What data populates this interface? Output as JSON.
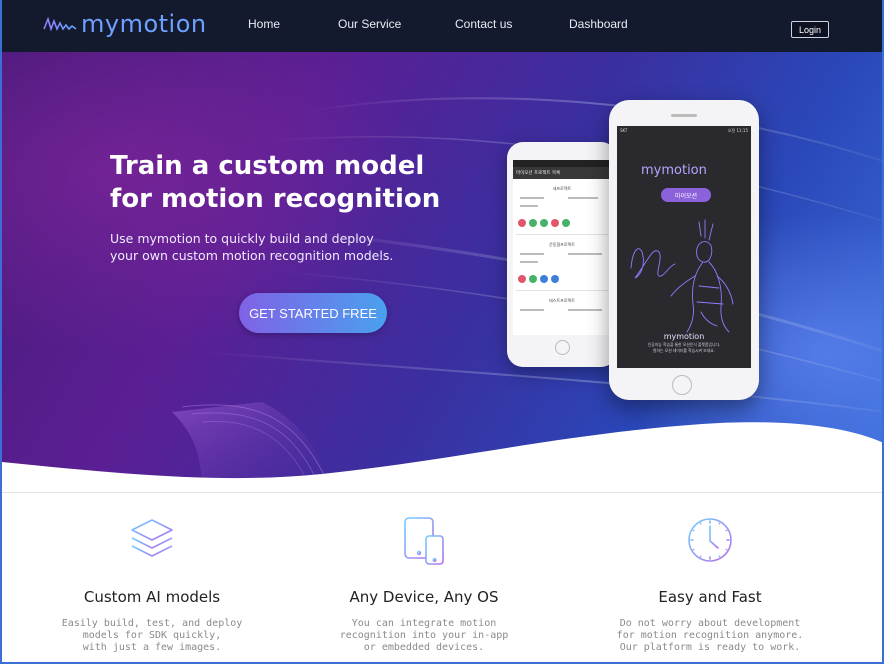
{
  "brand": {
    "name": "mymotion",
    "logo_color": "#6ea0ff"
  },
  "nav": {
    "items": [
      {
        "label": "Home"
      },
      {
        "label": "Our Service"
      },
      {
        "label": "Contact us"
      },
      {
        "label": "Dashboard"
      }
    ],
    "login_label": "Login"
  },
  "hero": {
    "title_line1": "Train a custom model",
    "title_line2": "for motion recognition",
    "subtitle_line1": "Use mymotion to quickly build and deploy",
    "subtitle_line2": "your own custom motion recognition models.",
    "cta_label": "GET STARTED FREE"
  },
  "phone_back": {
    "header": "마이모션 프로젝트 목록",
    "cards": [
      {
        "title": "새프로젝트"
      },
      {
        "title": "운동협프로젝트"
      },
      {
        "title": "테스트프로젝트"
      }
    ]
  },
  "phone_front": {
    "status_left": "SKT",
    "status_right": "오전 11:15",
    "app_logo": "mymotion",
    "button_label": "마이모션",
    "footer_brand": "mymotion",
    "footer_line1": "인공지능 학습을 통한 모션인식 플랫폼입니다.",
    "footer_line2": "원하는 모션 데이터를 학습시켜 보세요."
  },
  "features": [
    {
      "icon": "layers-icon",
      "title": "Custom AI models",
      "desc_line1": "Easily build, test, and deploy",
      "desc_line2": "models for SDK quickly,",
      "desc_line3": "with just a few images."
    },
    {
      "icon": "devices-icon",
      "title": "Any Device, Any OS",
      "desc_line1": "You can integrate motion",
      "desc_line2": "recognition into your in-app",
      "desc_line3": "or embedded devices."
    },
    {
      "icon": "clock-icon",
      "title": "Easy and Fast",
      "desc_line1": "Do not worry about development",
      "desc_line2": "for motion recognition anymore.",
      "desc_line3": "Our platform is ready to work."
    }
  ],
  "colors": {
    "nav_bg": "#141a2e",
    "hero_purple": "#5a1f94",
    "hero_blue": "#3c6fdb",
    "cta_start": "#8062e6",
    "cta_end": "#4aa0ee",
    "icon_gradient_start": "#7aa6ff",
    "icon_gradient_end": "#a86ee8"
  }
}
